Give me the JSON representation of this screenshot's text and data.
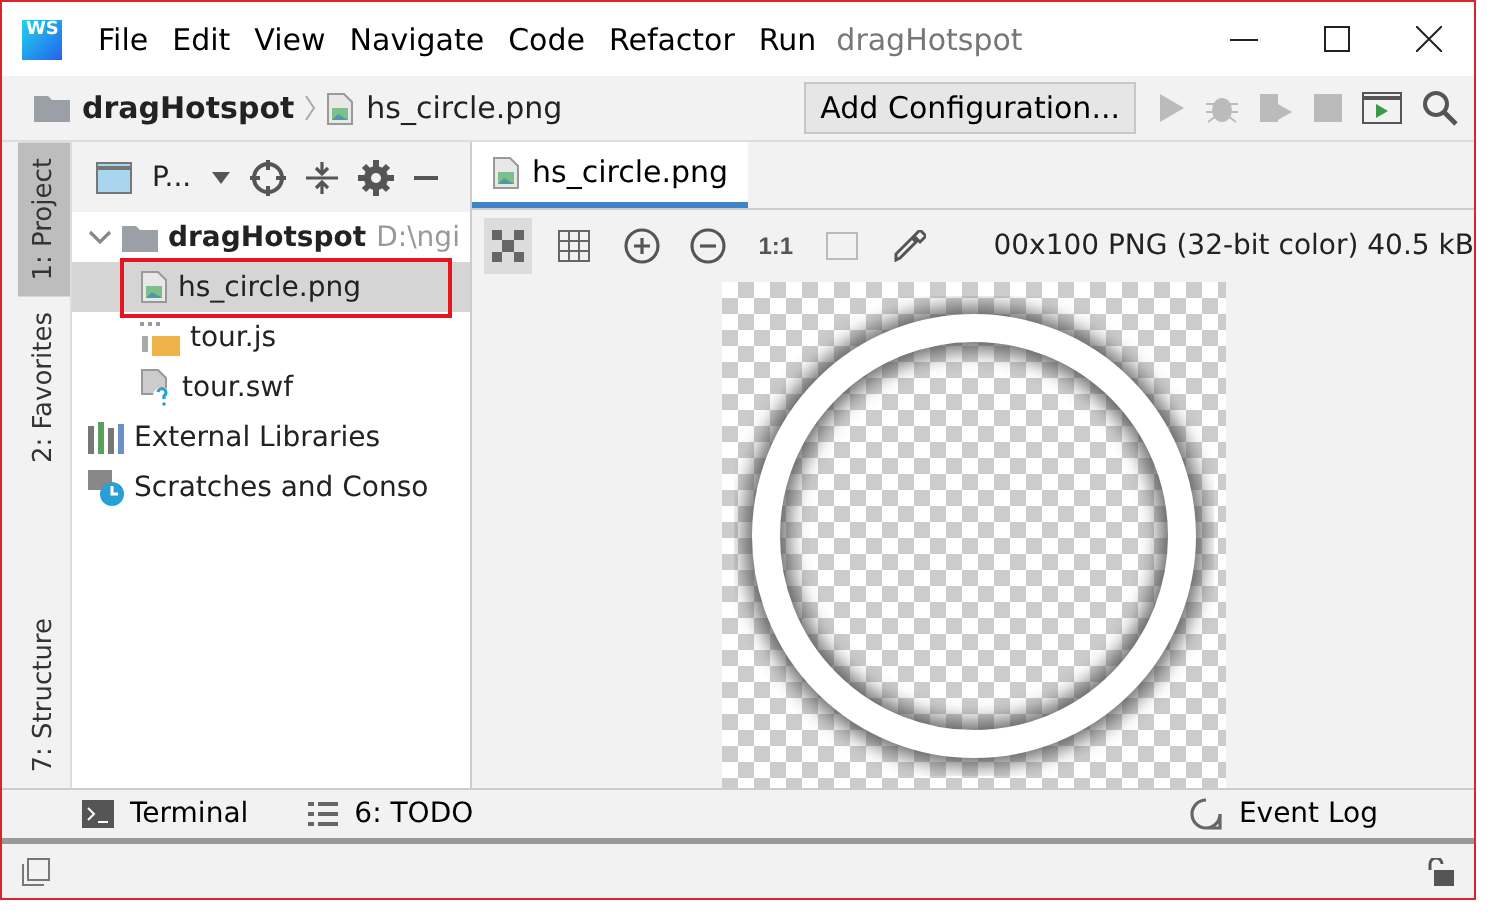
{
  "window": {
    "app_badge": "WS",
    "menu": [
      "File",
      "Edit",
      "View",
      "Navigate",
      "Code",
      "Refactor",
      "Run"
    ],
    "title": "dragHotspot"
  },
  "nav": {
    "crumbs": [
      {
        "label": "dragHotspot",
        "kind": "folder"
      },
      {
        "label": "hs_circle.png",
        "kind": "image"
      }
    ],
    "run_config": "Add Configuration..."
  },
  "left_stripe": [
    {
      "label": "1: Project",
      "selected": true
    },
    {
      "label": "2: Favorites",
      "selected": false
    },
    {
      "label": "7: Structure",
      "selected": false
    }
  ],
  "project": {
    "view_label": "P...",
    "tree": [
      {
        "label": "dragHotspot",
        "path": "D:\\ngi",
        "kind": "folder",
        "expanded": true,
        "selected": false,
        "children": [
          {
            "label": "hs_circle.png",
            "kind": "image",
            "selected": true
          },
          {
            "label": "tour.js",
            "kind": "js",
            "selected": false
          },
          {
            "label": "tour.swf",
            "kind": "unknown",
            "selected": false
          }
        ]
      },
      {
        "label": "External Libraries",
        "kind": "libraries",
        "selected": false
      },
      {
        "label": "Scratches and Conso",
        "kind": "scratches",
        "selected": false
      }
    ]
  },
  "editor": {
    "tabs": [
      {
        "label": "hs_circle.png",
        "selected": true
      }
    ],
    "zoom_label": "1:1",
    "image_info": "00x100 PNG (32-bit color) 40.5 kB"
  },
  "bottom_tools": [
    {
      "label": "Terminal",
      "kind": "terminal"
    },
    {
      "label": "6: TODO",
      "kind": "todo"
    }
  ],
  "event_log": "Event Log"
}
